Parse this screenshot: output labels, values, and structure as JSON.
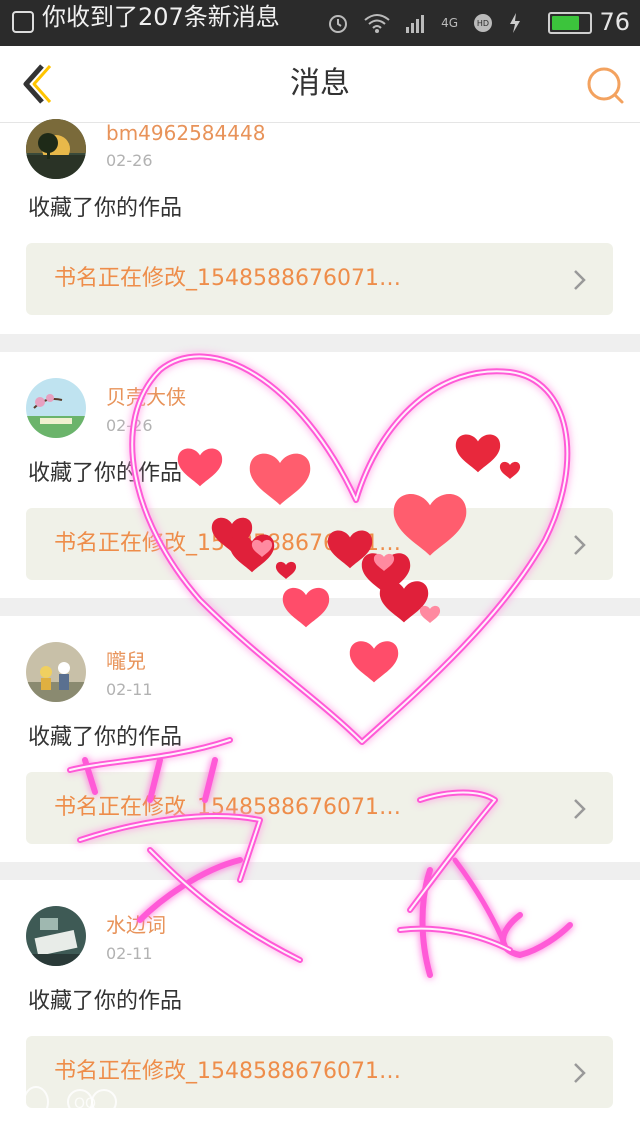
{
  "status_bar": {
    "notification": "你收到了207条新消息",
    "network": "4G",
    "battery": "76",
    "icons": [
      "alarm-icon",
      "wifi-icon",
      "signal-icon",
      "hd-icon",
      "charging-icon"
    ]
  },
  "nav": {
    "title": "消息",
    "back_icon": "back-chevron-icon",
    "search_icon": "search-icon"
  },
  "colors": {
    "accent": "#ee8d4a",
    "name": "#e8935a",
    "link_bg": "#f0f1e8",
    "doodle_line": "#ff4fd8",
    "heart": "#ff4d6a"
  },
  "messages": [
    {
      "user": "bm4962584448",
      "date": "02-26",
      "action": "收藏了你的作品",
      "work": "书名正在修改_1548588676071…"
    },
    {
      "user": "贝壳大侠",
      "date": "02-26",
      "action": "收藏了你的作品",
      "work": "书名正在修改_1548588676071…"
    },
    {
      "user": "嚨兒",
      "date": "02-11",
      "action": "收藏了你的作品",
      "work": "书名正在修改_1548588676071…"
    },
    {
      "user": "水边词",
      "date": "02-11",
      "action": "收藏了你的作品",
      "work": "书名正在修改_1548588676071…"
    }
  ],
  "watermark": "QQ"
}
